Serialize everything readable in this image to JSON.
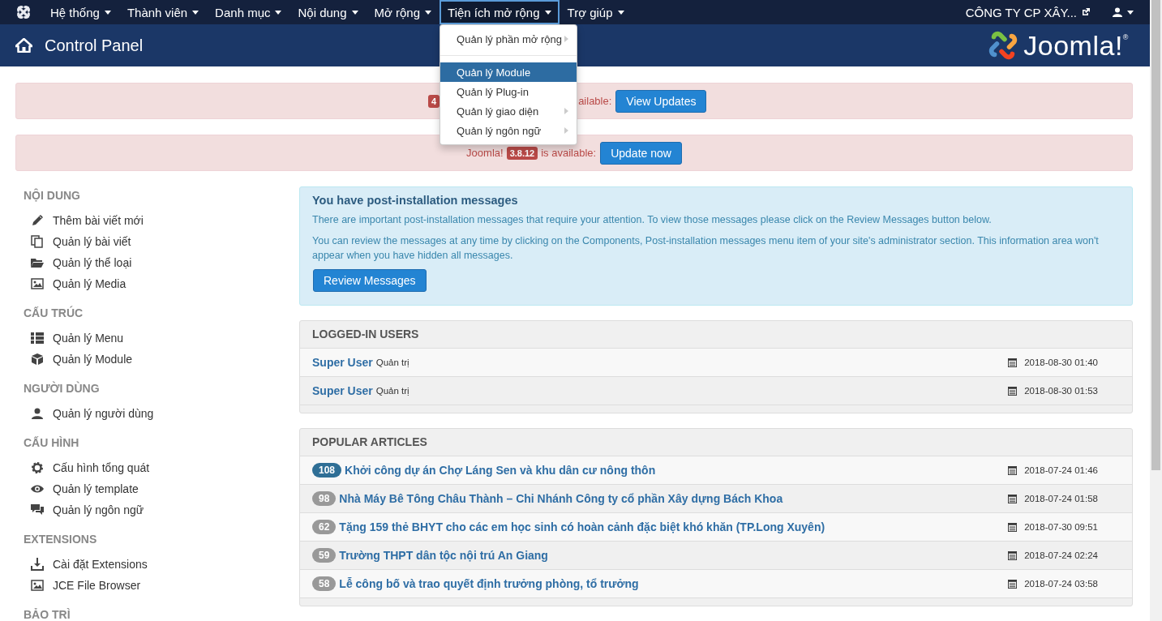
{
  "navbar": {
    "menus": [
      {
        "label": "Hệ thống",
        "open": false
      },
      {
        "label": "Thành viên",
        "open": false
      },
      {
        "label": "Danh mục",
        "open": false
      },
      {
        "label": "Nội dung",
        "open": false
      },
      {
        "label": "Mở rộng",
        "open": false
      },
      {
        "label": "Tiện ích mở rộng",
        "open": true
      },
      {
        "label": "Trợ giúp",
        "open": false
      }
    ],
    "site_link": "CÔNG TY CP XÂY...",
    "dropdown": {
      "items": [
        {
          "kind": "submenu",
          "label": "Quản lý phần mở rộng",
          "selected": false
        },
        {
          "kind": "divider"
        },
        {
          "kind": "link",
          "label": "Quản lý Module",
          "selected": true
        },
        {
          "kind": "link",
          "label": "Quản lý Plug-in",
          "selected": false
        },
        {
          "kind": "submenu",
          "label": "Quản lý giao diện",
          "selected": false
        },
        {
          "kind": "submenu",
          "label": "Quản lý ngôn ngữ",
          "selected": false
        }
      ]
    }
  },
  "header": {
    "title": "Control Panel",
    "logo_text": "Joomla!$^{®}$"
  },
  "alerts": [
    {
      "kind": "covered",
      "badge": "4",
      "text": "ailable:",
      "button": "View Updates"
    },
    {
      "kind": "full",
      "prefix": "Joomla!",
      "badge": "3.8.12",
      "text": "is available:",
      "button": "Update now"
    }
  ],
  "sidebar": {
    "sections": [
      {
        "title": "NỘI DUNG",
        "items": [
          {
            "kind": "pencil",
            "label": "Thêm bài viết mới"
          },
          {
            "kind": "copy",
            "label": "Quản lý bài viết"
          },
          {
            "kind": "folder",
            "label": "Quản lý thể loại"
          },
          {
            "kind": "image",
            "label": "Quản lý Media"
          }
        ]
      },
      {
        "title": "CẤU TRÚC",
        "items": [
          {
            "kind": "list",
            "label": "Quản lý Menu"
          },
          {
            "kind": "cube",
            "label": "Quản lý Module"
          }
        ]
      },
      {
        "title": "NGƯỜI DÙNG",
        "items": [
          {
            "kind": "user",
            "label": "Quản lý người dùng"
          }
        ]
      },
      {
        "title": "CẤU HÌNH",
        "items": [
          {
            "kind": "gear",
            "label": "Cấu hình tổng quát"
          },
          {
            "kind": "eye",
            "label": "Quản lý template"
          },
          {
            "kind": "chat",
            "label": "Quản lý ngôn ngữ"
          }
        ]
      },
      {
        "title": "EXTENSIONS",
        "items": [
          {
            "kind": "download",
            "label": "Cài đặt Extensions"
          },
          {
            "kind": "image",
            "label": "JCE File Browser"
          }
        ]
      },
      {
        "title": "BẢO TRÌ"
      }
    ]
  },
  "post_install": {
    "title": "You have post-installation messages",
    "paragraphs": [
      "There are important post-installation messages that require your attention. To view those messages please click on the Review Messages button below.",
      "You can review the messages at any time by clicking on the Components, Post-installation messages menu item of your site's administrator section. This information area won't appear when you have hidden all messages."
    ],
    "button": "Review Messages"
  },
  "logged_in": {
    "title": "LOGGED-IN USERS",
    "rows": [
      {
        "name": "Super User",
        "role": "Quản trị",
        "time": "2018-08-30 01:40"
      },
      {
        "name": "Super User",
        "role": "Quản trị",
        "time": "2018-08-30 01:53"
      }
    ]
  },
  "popular": {
    "title": "POPULAR ARTICLES",
    "rows": [
      {
        "hits": "108",
        "highlight": true,
        "title": "Khởi công dự án Chợ Láng Sen và khu dân cư nông thôn",
        "time": "2018-07-24 01:46"
      },
      {
        "hits": "98",
        "highlight": false,
        "title": "Nhà Máy Bê Tông Châu Thành – Chi Nhánh Công ty cổ phần Xây dựng Bách Khoa",
        "time": "2018-07-24 01:58"
      },
      {
        "hits": "62",
        "highlight": false,
        "title": "Tặng 159 thẻ BHYT cho các em học sinh có hoàn cảnh đặc biệt khó khăn (TP.Long Xuyên)",
        "time": "2018-07-30 09:51"
      },
      {
        "hits": "59",
        "highlight": false,
        "title": "Trường THPT dân tộc nội trú An Giang",
        "time": "2018-07-24 02:24"
      },
      {
        "hits": "58",
        "highlight": false,
        "title": "Lễ công bố và trao quyết định trưởng phòng, tổ trưởng",
        "time": "2018-07-24 03:58"
      }
    ]
  }
}
